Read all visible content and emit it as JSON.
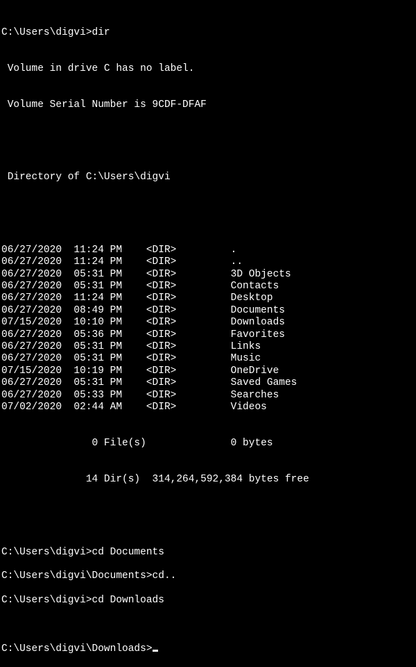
{
  "header": {
    "prompt_line": "C:\\Users\\digvi>dir",
    "volume_label": " Volume in drive C has no label.",
    "volume_serial": " Volume Serial Number is 9CDF-DFAF",
    "directory_of": " Directory of C:\\Users\\digvi"
  },
  "entries": [
    {
      "date": "06/27/2020",
      "time": "11:24 PM",
      "type": "<DIR>",
      "name": "."
    },
    {
      "date": "06/27/2020",
      "time": "11:24 PM",
      "type": "<DIR>",
      "name": ".."
    },
    {
      "date": "06/27/2020",
      "time": "05:31 PM",
      "type": "<DIR>",
      "name": "3D Objects"
    },
    {
      "date": "06/27/2020",
      "time": "05:31 PM",
      "type": "<DIR>",
      "name": "Contacts"
    },
    {
      "date": "06/27/2020",
      "time": "11:24 PM",
      "type": "<DIR>",
      "name": "Desktop"
    },
    {
      "date": "06/27/2020",
      "time": "08:49 PM",
      "type": "<DIR>",
      "name": "Documents"
    },
    {
      "date": "07/15/2020",
      "time": "10:10 PM",
      "type": "<DIR>",
      "name": "Downloads"
    },
    {
      "date": "06/27/2020",
      "time": "05:36 PM",
      "type": "<DIR>",
      "name": "Favorites"
    },
    {
      "date": "06/27/2020",
      "time": "05:31 PM",
      "type": "<DIR>",
      "name": "Links"
    },
    {
      "date": "06/27/2020",
      "time": "05:31 PM",
      "type": "<DIR>",
      "name": "Music"
    },
    {
      "date": "07/15/2020",
      "time": "10:19 PM",
      "type": "<DIR>",
      "name": "OneDrive"
    },
    {
      "date": "06/27/2020",
      "time": "05:31 PM",
      "type": "<DIR>",
      "name": "Saved Games"
    },
    {
      "date": "06/27/2020",
      "time": "05:33 PM",
      "type": "<DIR>",
      "name": "Searches"
    },
    {
      "date": "07/02/2020",
      "time": "02:44 AM",
      "type": "<DIR>",
      "name": "Videos"
    }
  ],
  "summary": {
    "files": "               0 File(s)              0 bytes",
    "dirs": "              14 Dir(s)  314,264,592,384 bytes free"
  },
  "commands": [
    {
      "prompt": "C:\\Users\\digvi>",
      "cmd": "cd Documents"
    },
    {
      "prompt": "C:\\Users\\digvi\\Documents>",
      "cmd": "cd.."
    },
    {
      "prompt": "C:\\Users\\digvi>",
      "cmd": "cd Downloads"
    }
  ],
  "current_prompt": "C:\\Users\\digvi\\Downloads>"
}
